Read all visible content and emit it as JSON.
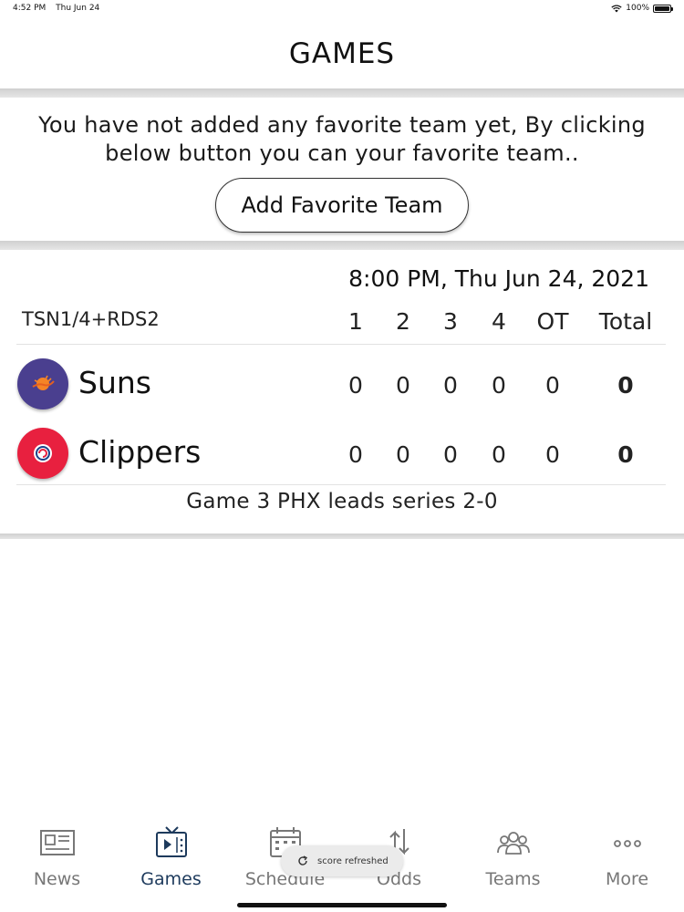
{
  "status_bar": {
    "time": "4:52 PM",
    "date": "Thu Jun 24",
    "battery": "100%",
    "icons": [
      "wifi-icon",
      "battery-icon"
    ]
  },
  "header": {
    "title": "GAMES"
  },
  "favorite": {
    "message": "You have not added any favorite team yet, By clicking below button you can your favorite team..",
    "button_label": "Add Favorite Team"
  },
  "game": {
    "time": "8:00 PM, Thu Jun 24, 2021",
    "network": "TSN1/4+RDS2",
    "columns": [
      "1",
      "2",
      "3",
      "4",
      "OT",
      "Total"
    ],
    "teams": [
      {
        "name": "Suns",
        "scores": [
          "0",
          "0",
          "0",
          "0",
          "0"
        ],
        "total": "0",
        "logo_color": "#4a3f8f",
        "icon": "suns-logo-icon"
      },
      {
        "name": "Clippers",
        "scores": [
          "0",
          "0",
          "0",
          "0",
          "0"
        ],
        "total": "0",
        "logo_color": "#e8203f",
        "icon": "clippers-logo-icon"
      }
    ],
    "series_note": "Game 3 PHX leads series 2-0"
  },
  "tabs": [
    {
      "label": "News",
      "icon": "newspaper-icon",
      "active": false
    },
    {
      "label": "Games",
      "icon": "tv-icon",
      "active": true
    },
    {
      "label": "Schedule",
      "icon": "calendar-icon",
      "active": false
    },
    {
      "label": "Odds",
      "icon": "arrows-updown-icon",
      "active": false
    },
    {
      "label": "Teams",
      "icon": "people-icon",
      "active": false
    },
    {
      "label": "More",
      "icon": "more-dots-icon",
      "active": false
    }
  ],
  "toast": {
    "text": "score refreshed",
    "icon": "refresh-icon"
  },
  "colors": {
    "active_tab": "#1d3a5c",
    "inactive_tab": "#777777",
    "separator": "#d9d9d9"
  }
}
